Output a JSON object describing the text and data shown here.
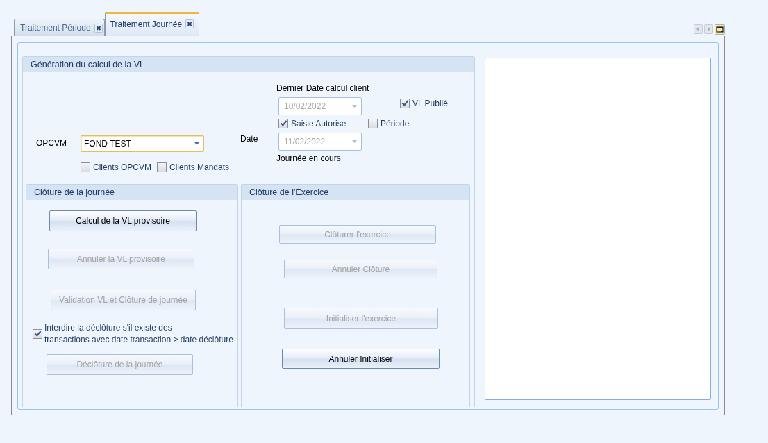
{
  "tabs": [
    {
      "label": "Traitement Période",
      "selected": false
    },
    {
      "label": "Traitement Journée",
      "selected": true
    }
  ],
  "generation": {
    "title": "Génération du calcul de la VL",
    "last_calc": {
      "label": "Dernier Date calcul client",
      "value": "10/02/2022",
      "disabled": true
    },
    "vl_publie": {
      "label": "VL Publié",
      "checked": true
    },
    "saisie_autorise": {
      "label": "Saisie Autorise",
      "checked": true
    },
    "periode": {
      "label": "Période",
      "checked": false
    },
    "opcvm": {
      "label": "OPCVM",
      "value": "FOND TEST",
      "focused": true
    },
    "date": {
      "label": "Date",
      "value": "11/02/2022",
      "disabled": true,
      "caption": "Journée en cours"
    },
    "clients_opcvm": {
      "label": "Clients OPCVM",
      "checked": false
    },
    "clients_mandats": {
      "label": "Clients Mandats",
      "checked": false
    }
  },
  "day_closing": {
    "title": "Clôture de la journée",
    "items": [
      {
        "kind": "button",
        "label": "Calcul de la VL provisoire",
        "disabled": false
      },
      {
        "kind": "button",
        "label": "Annuler la VL provisoire",
        "disabled": true
      },
      {
        "kind": "button",
        "label": "Validation VL et Clôture de journée",
        "disabled": true
      },
      {
        "kind": "checkbox",
        "label": "Interdire la déclôture s'il existe des\ntransactions avec date transaction > date déclôture",
        "checked": true
      },
      {
        "kind": "button",
        "label": "Déclôture de la journée",
        "disabled": true
      }
    ]
  },
  "year_closing": {
    "title": "Clôture de l'Exercice",
    "buttons": [
      {
        "label": "Clôturer l'exercice",
        "disabled": true
      },
      {
        "label": "Annuler Clôture",
        "disabled": true
      },
      {
        "label": "Initialiser l'exercice",
        "disabled": true
      },
      {
        "label": "Annuler Initialiser",
        "disabled": false
      }
    ]
  }
}
